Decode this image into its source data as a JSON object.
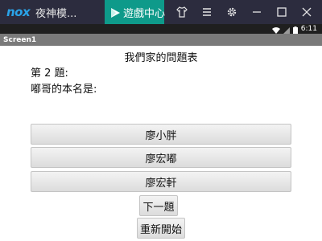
{
  "emulator": {
    "logo_text": "nox",
    "app_title": "夜神模...",
    "tab_label": "遊戲中心",
    "icons": [
      "shirt-icon",
      "menu-icon",
      "gear-icon",
      "minimize-icon",
      "maximize-icon",
      "close-icon"
    ],
    "colors": {
      "bar": "#2c2c3e",
      "tab": "#0e9a8a",
      "logo": "#2aa3e8"
    }
  },
  "status_bar": {
    "time": "6:11",
    "icons": [
      "wifi-icon",
      "signal-icon",
      "battery-icon"
    ]
  },
  "screen": {
    "title": "Screen1"
  },
  "question": {
    "heading": "我們家的問題表",
    "number": "第 2 題:",
    "text": "嘟哥的本名是:"
  },
  "options": [
    {
      "label": "廖小胖"
    },
    {
      "label": "廖宏嘟"
    },
    {
      "label": "廖宏軒"
    }
  ],
  "actions": {
    "next_label": "下一題",
    "restart_label": "重新開始"
  }
}
